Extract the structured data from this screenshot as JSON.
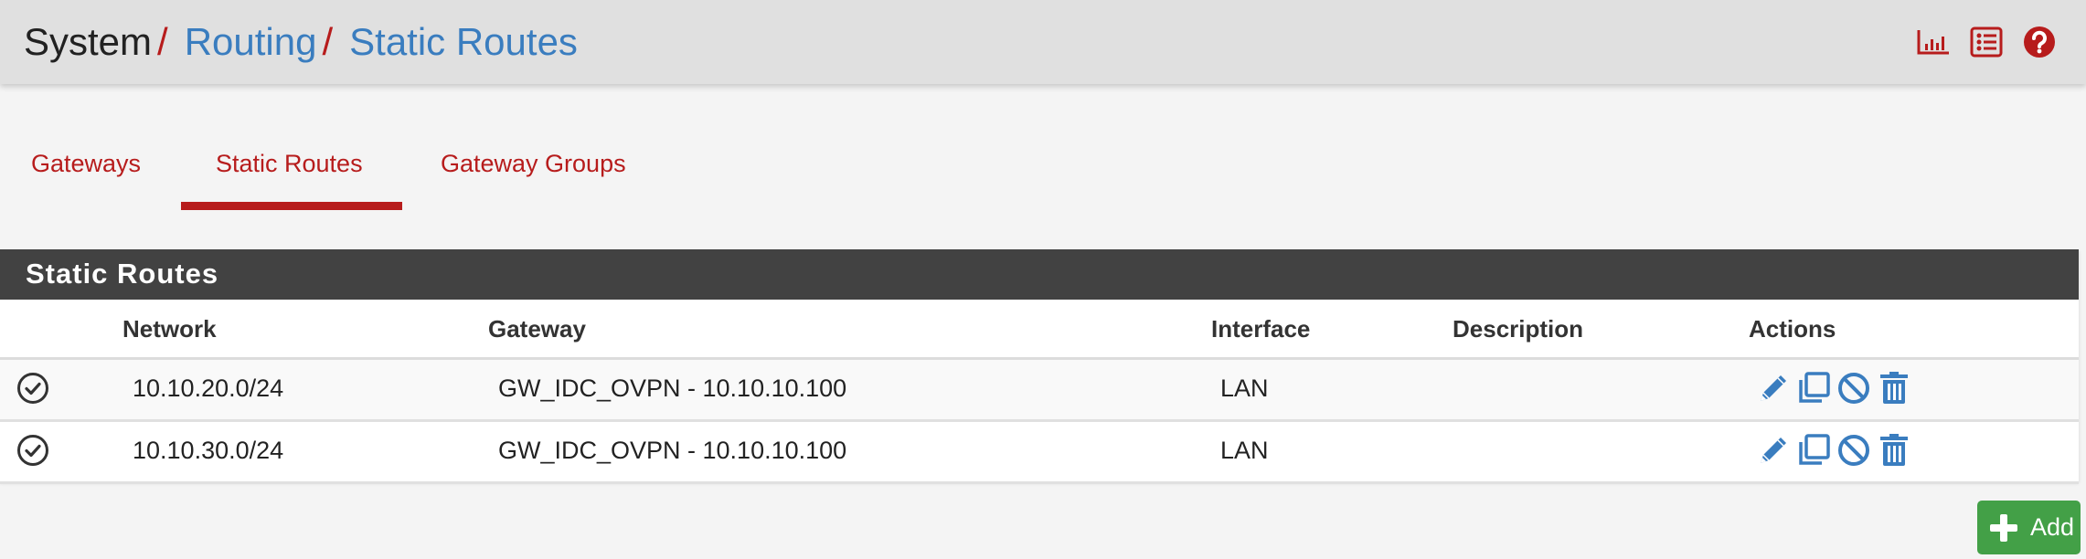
{
  "breadcrumb": {
    "items": [
      "System",
      "Routing",
      "Static Routes"
    ],
    "separator": "/"
  },
  "header_icons": [
    "chart-icon",
    "list-icon",
    "help-icon"
  ],
  "tabs": [
    {
      "label": "Gateways",
      "active": false
    },
    {
      "label": "Static Routes",
      "active": true
    },
    {
      "label": "Gateway Groups",
      "active": false
    }
  ],
  "panel": {
    "title": "Static Routes",
    "columns": [
      "Network",
      "Gateway",
      "Interface",
      "Description",
      "Actions"
    ],
    "rows": [
      {
        "status": "check-circle-icon",
        "network": "10.10.20.0/24",
        "gateway": "GW_IDC_OVPN - 10.10.10.100",
        "interface": "LAN",
        "description": ""
      },
      {
        "status": "check-circle-icon",
        "network": "10.10.30.0/24",
        "gateway": "GW_IDC_OVPN - 10.10.10.100",
        "interface": "LAN",
        "description": ""
      }
    ],
    "row_actions": [
      "edit",
      "copy",
      "disable",
      "delete"
    ]
  },
  "add_button": {
    "label": "Add"
  },
  "colors": {
    "accent_red": "#b71c1c",
    "link_blue": "#3a7dbf",
    "panel_heading": "#424242",
    "add_green": "#43a047"
  }
}
